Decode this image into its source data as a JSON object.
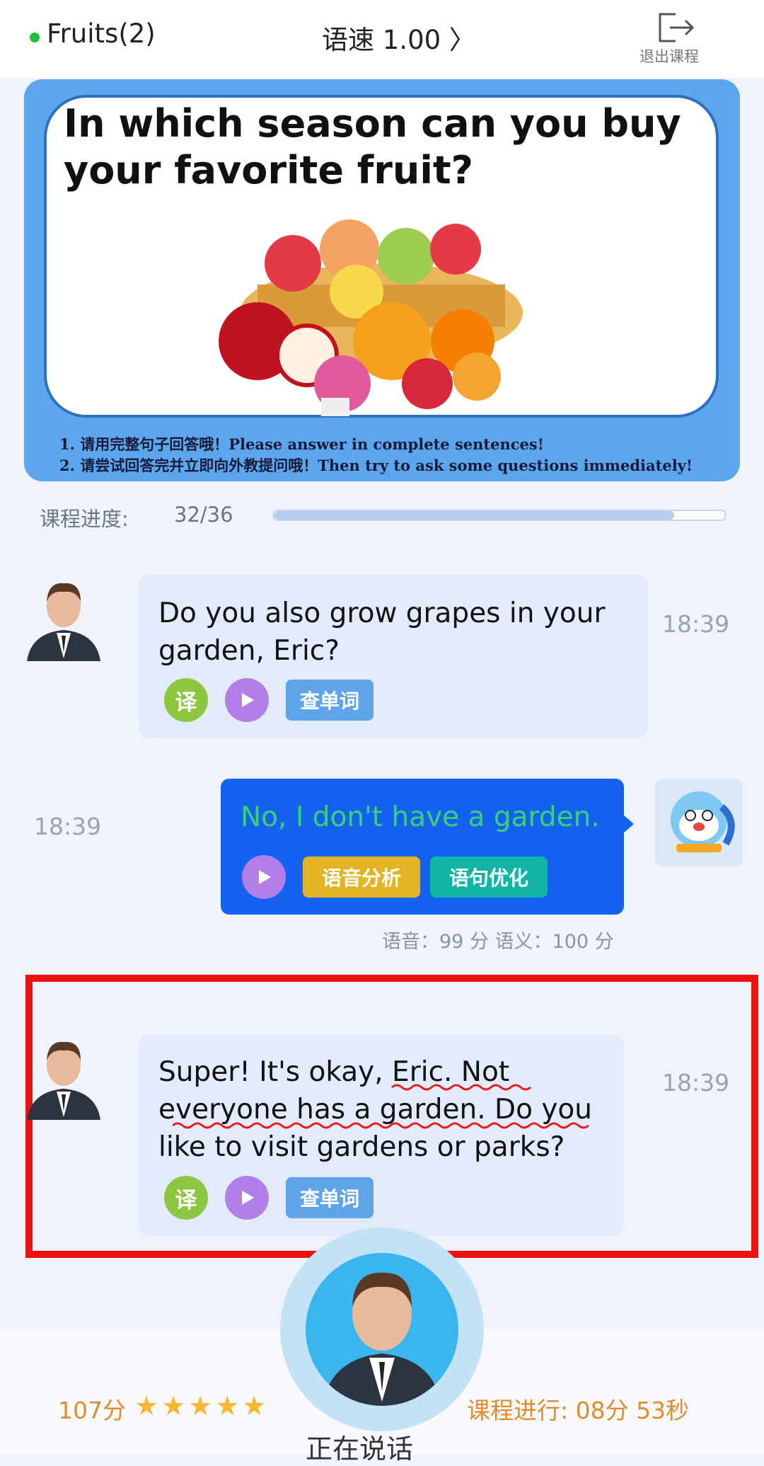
{
  "header": {
    "course_title": "Fruits(2)",
    "speed_label": "语速 1.00 〉",
    "exit_label": "退出课程",
    "exit_icon": "exit-icon"
  },
  "banner": {
    "question": "In which season can you buy your favorite fruit?",
    "tips": [
      "1. 请用完整句子回答哦！Please answer in complete sentences!",
      "2. 请尝试回答完并立即向外教提问哦！Then try to ask some questions immediately!"
    ]
  },
  "progress": {
    "label": "课程进度:",
    "value": "32/36",
    "fraction": 0.889
  },
  "messages": [
    {
      "sender": "teacher",
      "text_lines": [
        "Do you also grow grapes in your",
        "garden, Eric?"
      ],
      "time": "18:39",
      "translate_label": "译",
      "lookup_label": "查单词"
    },
    {
      "sender": "student",
      "text": "No, I don't have a garden.",
      "time": "18:39",
      "analysis_label": "语音分析",
      "optimize_label": "语句优化",
      "score_text": "语音：99 分 语义：100 分"
    },
    {
      "sender": "teacher",
      "text_lines": [
        "Super! It's okay, Eric. Not",
        "everyone has a garden. Do you",
        "like to visit gardens or parks?"
      ],
      "time": "18:39",
      "translate_label": "译",
      "lookup_label": "查单词"
    }
  ],
  "bottom": {
    "score": "107分",
    "stars": "★★★★★",
    "star_count": 5,
    "elapsed": "课程进行: 08分 53秒",
    "status": "正在说话"
  },
  "colors": {
    "accent_blue": "#1562f0",
    "student_text": "#3ad07a",
    "highlight_red": "#ee1111",
    "translate_green": "#8dc63f",
    "play_purple": "#b27ee8",
    "lookup_blue": "#5fa3e8",
    "analysis_yellow": "#e4b323",
    "optimize_teal": "#11b5a8"
  }
}
